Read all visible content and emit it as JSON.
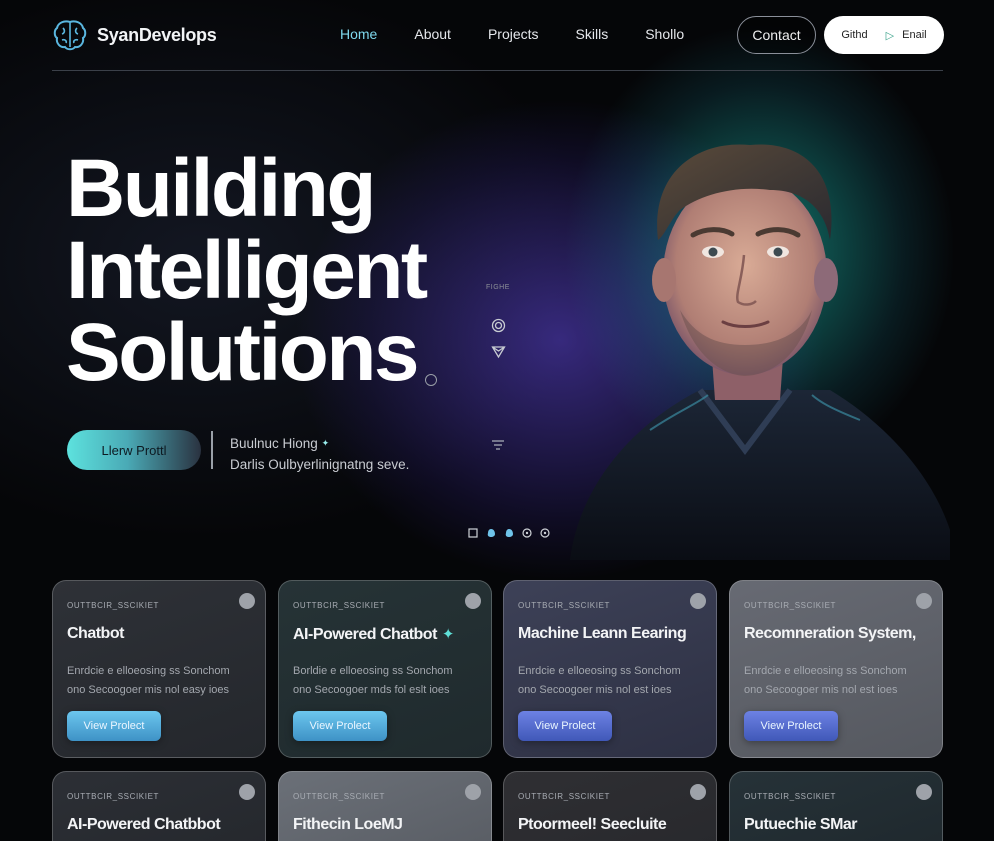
{
  "nav": {
    "brand": "SyanDevelops",
    "links": [
      {
        "label": "Home",
        "active": true
      },
      {
        "label": "About",
        "active": false
      },
      {
        "label": "Projects",
        "active": false
      },
      {
        "label": "Skills",
        "active": false
      },
      {
        "label": "Shollo",
        "active": false
      }
    ],
    "contact_label": "Contact",
    "github_label": "Githd",
    "email_label": "Enail"
  },
  "hero": {
    "title_lines": [
      "Building",
      "Intelligent",
      "Solutions"
    ],
    "cta_label": "Llerw Prottl",
    "tagline_line1": "Buulnuc Hiong",
    "tagline_line2": "Darlis Oulbyerlinignatng seve.",
    "side_label": "FIGHE",
    "carousel_dots": 5
  },
  "cards": [
    {
      "kicker": "OUTTBCIR_SSCIKIET",
      "title": "Chatbot",
      "desc1": "Enrdcie e elloeosing ss Sonchom",
      "desc2": "ono Secoogoer mis nol easy ioes",
      "button": "View Prolect",
      "style": "bg-a",
      "btn": "btn-cyan"
    },
    {
      "kicker": "OUTTBCIR_SSCIKIET",
      "title": "AI-Powered Chatbot",
      "desc1": "Borldie e elloeosing ss Sonchom",
      "desc2": "ono Secoogoer mds fol eslt ioes",
      "button": "View Prolect",
      "style": "bg-b",
      "btn": "btn-cyan",
      "star": true
    },
    {
      "kicker": "OUTTBCIR_SSCIKIET",
      "title": "Machine Leann Eearing",
      "desc1": "Enrdcie e elloeosing ss Sonchom",
      "desc2": "ono Secoogoer mis nol est ioes",
      "button": "View Prolect",
      "style": "bg-c",
      "btn": "btn-blue"
    },
    {
      "kicker": "OUTTBCIR_SSCIKIET",
      "title": "Recomneration System,",
      "desc1": "Enrdcie e elloeosing ss Sonchom",
      "desc2": "ono Secoogoer mis nol est ioes",
      "button": "View Prolect",
      "style": "bg-d",
      "btn": "btn-blue"
    },
    {
      "kicker": "OUTTBCIR_SSCIKIET",
      "title": "AI-Powered Chatbbot",
      "style": "bg-e"
    },
    {
      "kicker": "OUTTBCIR_SSCIKIET",
      "title": "Fithecin LoeMJ",
      "style": "bg-f"
    },
    {
      "kicker": "OUTTBCIR_SSCIKIET",
      "title": "Ptoormeel! Seecluite",
      "style": "bg-g"
    },
    {
      "kicker": "OUTTBCIR_SSCIKIET",
      "title": "Putuechie SMar",
      "style": "bg-h"
    }
  ]
}
